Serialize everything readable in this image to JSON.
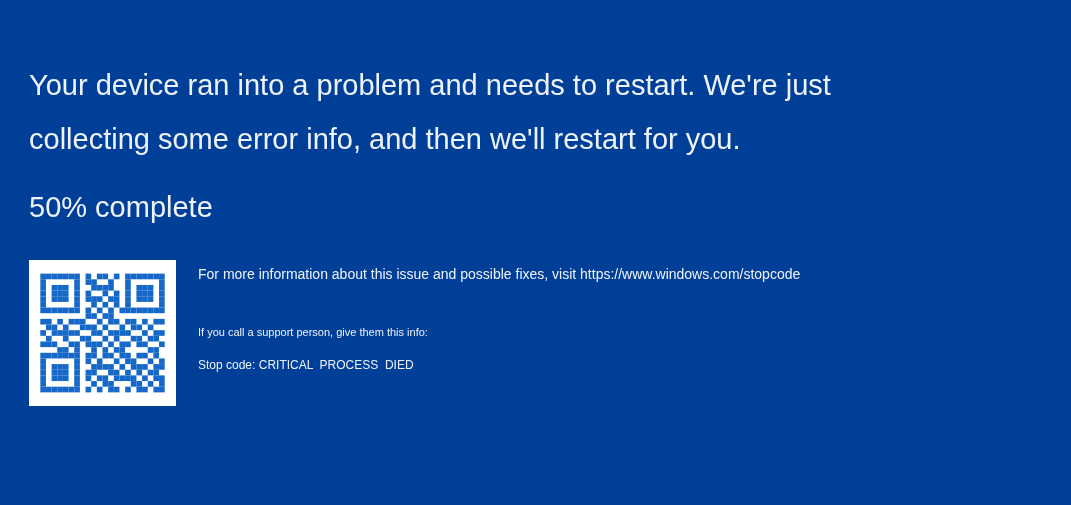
{
  "message": {
    "lines": [
      "Your device ran into a problem and needs to restart. We're just",
      "collecting some error info, and then we'll restart for you."
    ]
  },
  "progress": "50% complete",
  "details": {
    "info": "For more information about this issue and possible fixes, visit https://www.windows.com/stopcode",
    "support": "If you call a support person, give them this info:",
    "stop_code": "Stop code: CRITICAL  PROCESS  DIED"
  }
}
